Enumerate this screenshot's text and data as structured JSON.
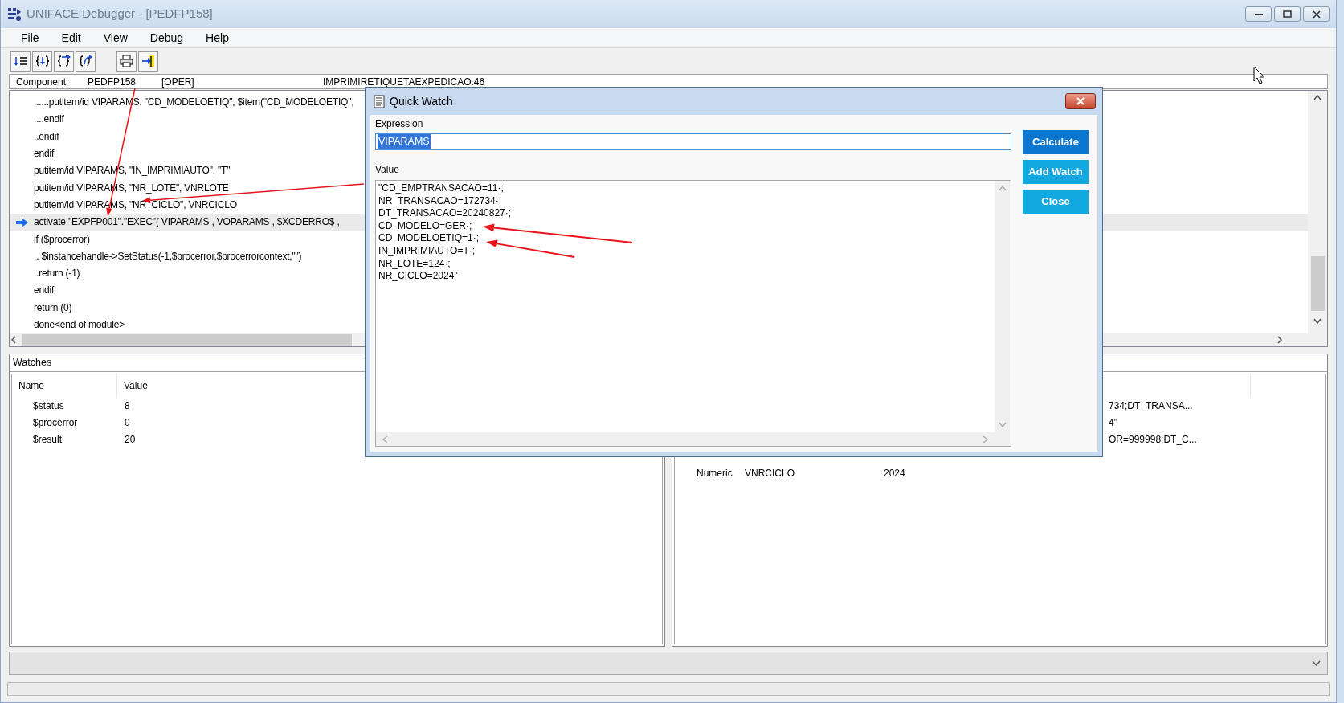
{
  "window": {
    "title": "UNIFACE Debugger - [PEDFP158]"
  },
  "menu": [
    "File",
    "Edit",
    "View",
    "Debug",
    "Help"
  ],
  "component_bar": {
    "label": "Component",
    "name": "PEDFP158",
    "type": "[OPER]",
    "location": "IMPRIMIRETIQUETAEXPEDICAO:46"
  },
  "code": {
    "lines": [
      {
        "text": "......putitem/id VIPARAMS, \"CD_MODELOETIQ\", $item(\"CD_MODELOETIQ\",",
        "current": false
      },
      {
        "text": "....endif",
        "current": false
      },
      {
        "text": "..endif",
        "current": false
      },
      {
        "text": "endif",
        "current": false
      },
      {
        "text": "putitem/id VIPARAMS, \"IN_IMPRIMIAUTO\", \"T\"",
        "current": false
      },
      {
        "text": "putitem/id VIPARAMS, \"NR_LOTE\", VNRLOTE",
        "current": false
      },
      {
        "text": "putitem/id VIPARAMS, \"NR_CICLO\", VNRCICLO",
        "current": false
      },
      {
        "text": "activate \"EXPFP001\".\"EXEC\"( VIPARAMS , VOPARAMS , $XCDERRO$ ,",
        "current": true
      },
      {
        "text": "if ($procerror)",
        "current": false
      },
      {
        "text": ".. $instancehandle->SetStatus(-1,$procerror,$procerrorcontext,\"\")",
        "current": false
      },
      {
        "text": "..return (-1)",
        "current": false
      },
      {
        "text": "endif",
        "current": false
      },
      {
        "text": "return (0)",
        "current": false
      },
      {
        "text": "done<end of module>",
        "current": false
      }
    ]
  },
  "watches": {
    "title": "Watches",
    "columns": [
      "Name",
      "Value"
    ],
    "rows": [
      {
        "name": "$status",
        "value": "8"
      },
      {
        "name": "$procerror",
        "value": "0"
      },
      {
        "name": "$result",
        "value": "20"
      }
    ]
  },
  "variables": {
    "rows": [
      {
        "column_3": "734;DT_TRANSA..."
      },
      {
        "column_3": "4\""
      },
      {
        "column_3": "OR=999998;DT_C..."
      },
      {
        "column_1": "Numeric",
        "column_2": "VNRCICLO",
        "column_3": "2024"
      }
    ]
  },
  "dialog": {
    "title": "Quick Watch",
    "expression": {
      "label": "Expression",
      "value": "VIPARAMS",
      "text_selected": true
    },
    "value": {
      "label": "Value",
      "lines": [
        "\"CD_EMPTRANSACAO=11·;",
        "NR_TRANSACAO=172734·;",
        "DT_TRANSACAO=20240827·;",
        "CD_MODELO=GER·;",
        "CD_MODELOETIQ=1·;",
        "IN_IMPRIMIAUTO=T·;",
        "NR_LOTE=124·;",
        "NR_CICLO=2024\""
      ]
    },
    "buttons": [
      {
        "label": "Calculate",
        "default": true
      },
      {
        "label": "Add Watch",
        "default": false
      },
      {
        "label": "Close",
        "default": false
      }
    ]
  }
}
